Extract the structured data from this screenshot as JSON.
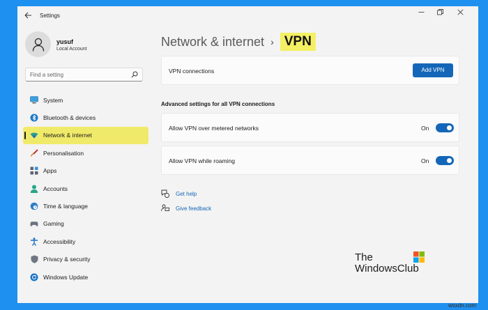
{
  "window": {
    "title": "Settings"
  },
  "user": {
    "name": "yusuf",
    "subtitle": "Local Account"
  },
  "search": {
    "placeholder": "Find a setting"
  },
  "sidebar": {
    "items": [
      {
        "label": "System",
        "icon": "monitor-icon",
        "active": false
      },
      {
        "label": "Bluetooth & devices",
        "icon": "bluetooth-icon",
        "active": false
      },
      {
        "label": "Network & internet",
        "icon": "wifi-icon",
        "active": true
      },
      {
        "label": "Personalisation",
        "icon": "brush-icon",
        "active": false
      },
      {
        "label": "Apps",
        "icon": "apps-icon",
        "active": false
      },
      {
        "label": "Accounts",
        "icon": "person-icon",
        "active": false
      },
      {
        "label": "Time & language",
        "icon": "globe-clock-icon",
        "active": false
      },
      {
        "label": "Gaming",
        "icon": "gamepad-icon",
        "active": false
      },
      {
        "label": "Accessibility",
        "icon": "accessibility-icon",
        "active": false
      },
      {
        "label": "Privacy & security",
        "icon": "shield-icon",
        "active": false
      },
      {
        "label": "Windows Update",
        "icon": "update-icon",
        "active": false
      }
    ]
  },
  "breadcrumb": {
    "parent": "Network & internet",
    "separator": "›",
    "current": "VPN"
  },
  "vpn": {
    "label": "VPN connections",
    "add_button": "Add VPN"
  },
  "advanced": {
    "title": "Advanced settings for all VPN connections",
    "toggles": [
      {
        "label": "Allow VPN over metered networks",
        "state": "On",
        "value": true
      },
      {
        "label": "Allow VPN while roaming",
        "state": "On",
        "value": true
      }
    ]
  },
  "links": {
    "help": "Get help",
    "feedback": "Give feedback"
  },
  "logo": {
    "line1": "The",
    "line2": "WindowsClub"
  },
  "watermark": "wsxdn.com",
  "colors": {
    "accent": "#1467b8",
    "highlight": "#f0ea6a",
    "background": "#1e90ef"
  }
}
